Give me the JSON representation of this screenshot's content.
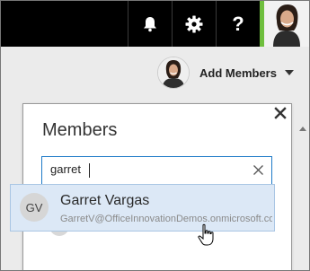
{
  "topbar": {
    "bell_icon": "notification-bell-icon",
    "gear_icon": "settings-gear-icon",
    "help_label": "?",
    "accent": "#6fbf3e"
  },
  "header": {
    "add_members_label": "Add Members"
  },
  "members_panel": {
    "title": "Members",
    "search_value": "garret"
  },
  "suggestion": {
    "initials": "GV",
    "name": "Garret Vargas",
    "email": "GarretV@OfficeInnovationDemos.onmicrosoft.com"
  }
}
